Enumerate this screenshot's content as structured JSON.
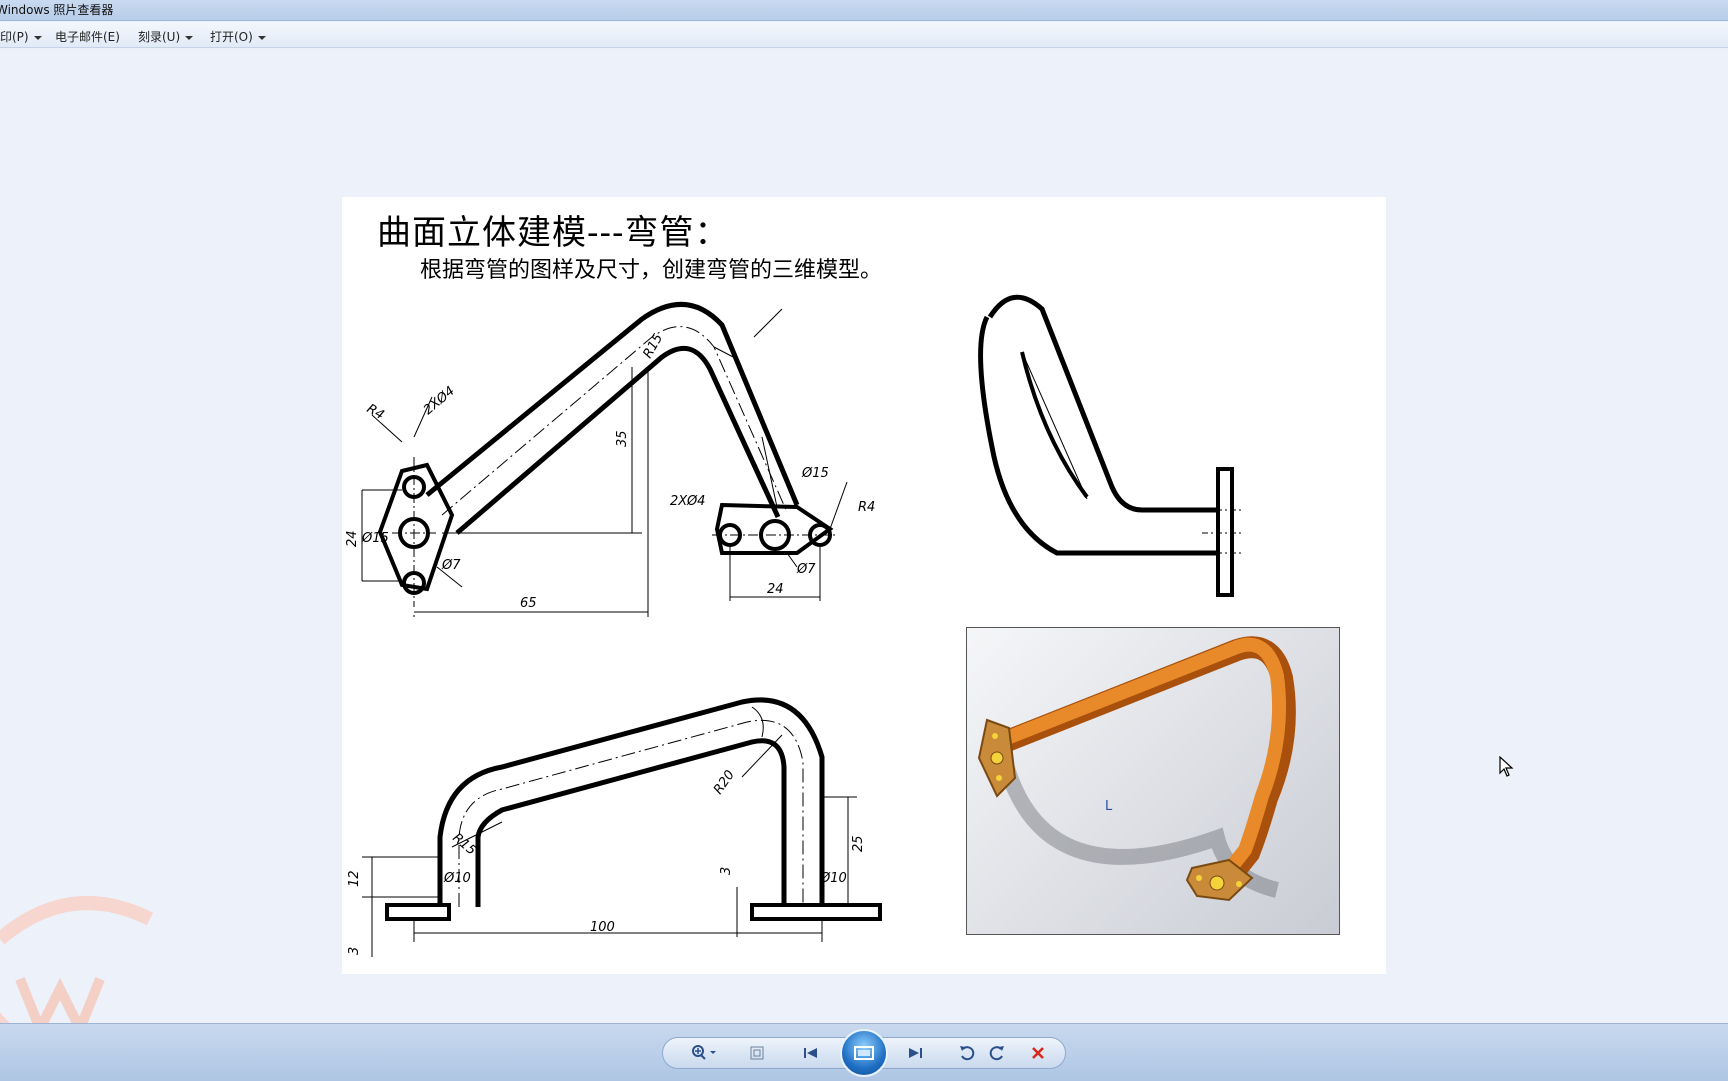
{
  "window": {
    "title": "Windows 照片查看器"
  },
  "menu": [
    {
      "label": "印(P)",
      "dropdown": true
    },
    {
      "label": "电子邮件(E)",
      "dropdown": false
    },
    {
      "label": "刻录(U)",
      "dropdown": true
    },
    {
      "label": "打开(O)",
      "dropdown": true
    }
  ],
  "photo": {
    "heading": "曲面立体建模---弯管：",
    "subheading": "根据弯管的图样及尺寸，创建弯管的三维模型。",
    "dims": {
      "r4_left": "R4",
      "holes_left": "2XØ4",
      "r15_top": "R15",
      "d35": "35",
      "d24_left": "24",
      "phi15_left": "Ø15",
      "phi7_left": "Ø7",
      "d65": "65",
      "holes_right": "2XØ4",
      "phi15_right": "Ø15",
      "r4_right": "R4",
      "phi7_right": "Ø7",
      "d24_right": "24",
      "r20": "R20",
      "r15_bottom": "R15",
      "d12": "12",
      "phi10_left": "Ø10",
      "d3_mid": "3",
      "phi10_right": "Ø10",
      "d25": "25",
      "d100": "100",
      "d3_bottom": "3",
      "render_mark": "L"
    }
  },
  "colors": {
    "pipe": "#e07a1a",
    "pipe_dark": "#a8500c",
    "flange": "#c98a3a"
  },
  "toolbar": {
    "icons": [
      "zoom-icon",
      "fit-icon",
      "previous-icon",
      "slideshow-icon",
      "next-icon",
      "rotate-left-icon",
      "rotate-right-icon",
      "delete-icon"
    ]
  }
}
